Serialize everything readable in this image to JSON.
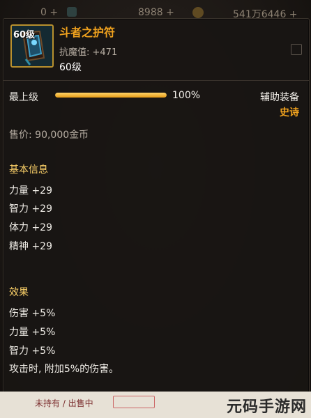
{
  "topbar": {
    "val1": "0 +",
    "val2": "8988 +",
    "val3": "541万6446 +",
    "gem_icon": "gem-icon",
    "coin_icon": "coin-icon"
  },
  "item": {
    "level_tag": "60级",
    "name": "斗者之护符",
    "stat": "抗魔值: +471",
    "level": "60级",
    "icon": "amulet-icon"
  },
  "grade": {
    "label": "最上级",
    "percent_text": "100%",
    "progress": 1.0
  },
  "slot": {
    "type": "辅助装备",
    "rarity": "史诗"
  },
  "price": "售价: 90,000金币",
  "basic": {
    "title": "基本信息",
    "stats": [
      "力量 +29",
      "智力 +29",
      "体力 +29",
      "精神 +29"
    ]
  },
  "effects": {
    "title": "效果",
    "lines": [
      "伤害 +5%",
      "力量 +5%",
      "智力 +5%",
      "攻击时, 附加5%的伤害。"
    ]
  },
  "bottom": {
    "status": "未持有 / 出售中"
  },
  "watermark": "元码手游网",
  "colors": {
    "epic": "#f0a21e",
    "bar": "#ffb92e"
  }
}
